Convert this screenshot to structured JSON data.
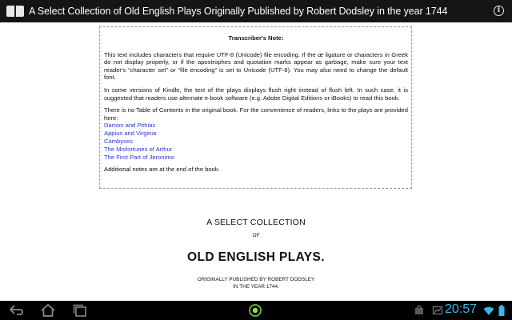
{
  "header": {
    "title": "A Select Collection of Old English Plays Originally Published by Robert Dodsley in the year 1744",
    "app_icon": "open-book-icon",
    "info_icon": "info-icon",
    "info_glyph": "i"
  },
  "note": {
    "heading": "Transcriber's Note:",
    "paragraphs": [
      "This text includes characters that require UTF-8 (Unicode) file encoding. If the œ ligature or characters in Greek do not display properly, or if the apostrophes and quotation marks appear as garbage, make sure your text reader's “character set” or “file encoding” is set to Unicode (UTF-8). You may also need to change the default font.",
      "In some versions of Kindle, the text of the plays displays flush right instead of flush left. In such case, it is suggested that readers use alternate e-book software (e.g. Adobe Digital Editions or iBooks) to read this book.",
      "There is no Table of Contents in the original book. For the convenience of readers, links to the plays are provided here:"
    ],
    "links": [
      "Damon and Pithias",
      "Appius and Virginia",
      "Cambyses",
      "The Misfortunes of Arthur",
      "The First Part of Jeronimo"
    ],
    "closing": "Additional notes are at the end of the book."
  },
  "book_title": {
    "line1": "A SELECT COLLECTION",
    "line2": "OF",
    "line3": "OLD ENGLISH PLAYS.",
    "line4": "ORIGINALLY PUBLISHED BY ROBERT DODSLEY",
    "line5": "IN THE YEAR 1744."
  },
  "system_bar": {
    "time": "20:57",
    "back_icon": "back-arrow-icon",
    "home_icon": "home-icon",
    "recents_icon": "recent-apps-icon",
    "center_icon": "notification-ring-icon",
    "clock_color": "#39b7e6"
  }
}
